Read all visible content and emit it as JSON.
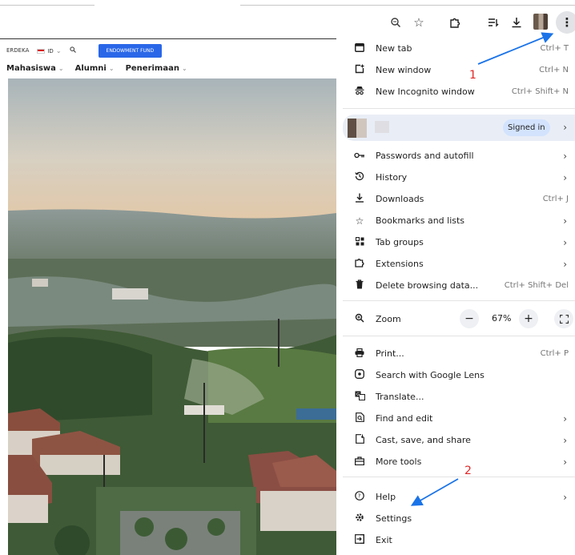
{
  "toolbar": {
    "icons": [
      "zoom-icon",
      "bookmark-star-icon",
      "extensions-icon",
      "reading-list-icon",
      "download-icon",
      "profile-avatar",
      "more-menu-icon"
    ]
  },
  "page": {
    "top_links": [
      "ERDEKA",
      "ID"
    ],
    "endowment_label": "ENDOWMENT FUND",
    "nav": [
      "Mahasiswa",
      "Alumni",
      "Penerimaan"
    ]
  },
  "menu": {
    "items": [
      {
        "id": "new-tab",
        "icon": "new-tab-icon",
        "label": "New tab",
        "shortcut": "Ctrl+ T"
      },
      {
        "id": "new-window",
        "icon": "new-window-icon",
        "label": "New window",
        "shortcut": "Ctrl+ N"
      },
      {
        "id": "new-incognito-window",
        "icon": "incognito-icon",
        "label": "New Incognito window",
        "shortcut": "Ctrl+ Shift+ N"
      },
      {
        "id": "passwords-and-autofill",
        "icon": "key-icon",
        "label": "Passwords and autofill",
        "shortcut": ""
      },
      {
        "id": "history",
        "icon": "history-icon",
        "label": "History",
        "shortcut": ""
      },
      {
        "id": "downloads",
        "icon": "download-icon",
        "label": "Downloads",
        "shortcut": "Ctrl+ J"
      },
      {
        "id": "bookmarks-and-lists",
        "icon": "star-icon",
        "label": "Bookmarks and lists",
        "shortcut": ""
      },
      {
        "id": "tab-groups",
        "icon": "tab-groups-icon",
        "label": "Tab groups",
        "shortcut": ""
      },
      {
        "id": "extensions",
        "icon": "puzzle-icon",
        "label": "Extensions",
        "shortcut": ""
      },
      {
        "id": "delete-browsing-data",
        "icon": "trash-icon",
        "label": "Delete browsing data...",
        "shortcut": "Ctrl+ Shift+ Del"
      },
      {
        "id": "zoom",
        "icon": "zoom-icon",
        "label": "Zoom",
        "shortcut": ""
      },
      {
        "id": "print",
        "icon": "print-icon",
        "label": "Print...",
        "shortcut": "Ctrl+ P"
      },
      {
        "id": "search-with-google-lens",
        "icon": "lens-icon",
        "label": "Search with Google Lens",
        "shortcut": ""
      },
      {
        "id": "translate",
        "icon": "translate-icon",
        "label": "Translate...",
        "shortcut": ""
      },
      {
        "id": "find-and-edit",
        "icon": "find-icon",
        "label": "Find and edit",
        "shortcut": ""
      },
      {
        "id": "cast-save-and-share",
        "icon": "cast-icon",
        "label": "Cast, save, and share",
        "shortcut": ""
      },
      {
        "id": "more-tools",
        "icon": "toolbox-icon",
        "label": "More tools",
        "shortcut": ""
      },
      {
        "id": "help",
        "icon": "help-icon",
        "label": "Help",
        "shortcut": ""
      },
      {
        "id": "settings",
        "icon": "settings-gear-icon",
        "label": "Settings",
        "shortcut": ""
      },
      {
        "id": "exit",
        "icon": "exit-icon",
        "label": "Exit",
        "shortcut": ""
      }
    ],
    "profile": {
      "signed_in_label": "Signed in"
    },
    "zoom": {
      "value": "67%",
      "minus": "−",
      "plus": "+"
    }
  },
  "annotations": {
    "labels": [
      "1",
      "2"
    ],
    "color": "#e02828",
    "arrow_color": "#1a73e8"
  },
  "colors": {
    "menu_bg": "#ffffff",
    "profile_bg": "#e9eef6",
    "signed_in_chip": "#d3e3fd",
    "endowment_button": "#2a67e8"
  }
}
